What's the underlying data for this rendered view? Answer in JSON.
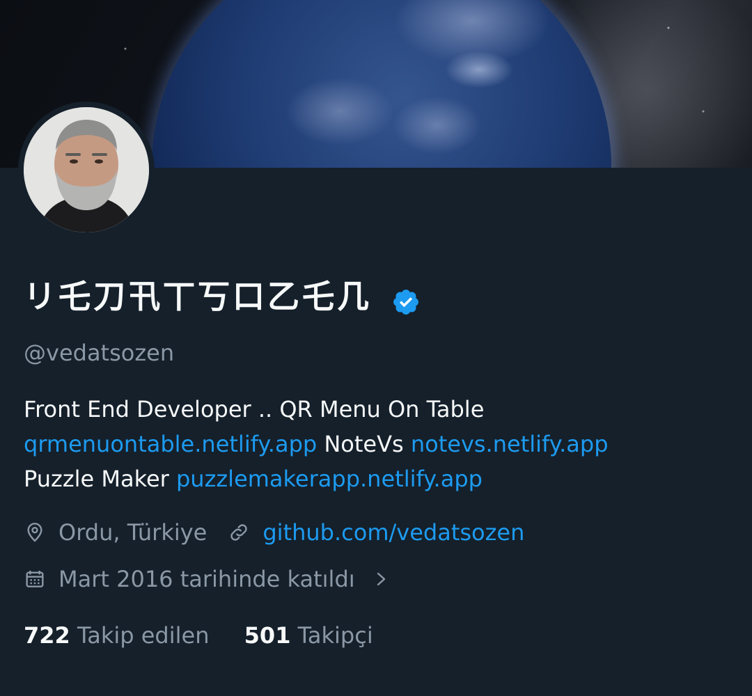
{
  "profile": {
    "display_name": "リ乇刀卂丅丂口乙乇几",
    "handle": "@vedatsozen",
    "verified": true,
    "bio": {
      "line1": "Front End Developer ..  QR Menu On Table",
      "link1": "qrmenuontable.netlify.app",
      "text2": " NoteVs ",
      "link2": "notevs.netlify.app",
      "text3": "Puzzle Maker ",
      "link3": "puzzlemakerapp.netlify.app"
    },
    "location": "Ordu, Türkiye",
    "website": "github.com/vedatsozen",
    "joined": "Mart 2016 tarihinde katıldı",
    "following_count": "722",
    "following_label": "Takip edilen",
    "followers_count": "501",
    "followers_label": "Takipçi"
  },
  "icons": {
    "verified": "verified-badge-icon",
    "location": "location-pin-icon",
    "website": "link-icon",
    "joined": "calendar-icon",
    "more": "chevron-right-icon"
  },
  "colors": {
    "background": "#15202b",
    "accent": "#1d9bf0",
    "secondary_text": "#8b98a5",
    "primary_text": "#f7f9f9"
  }
}
